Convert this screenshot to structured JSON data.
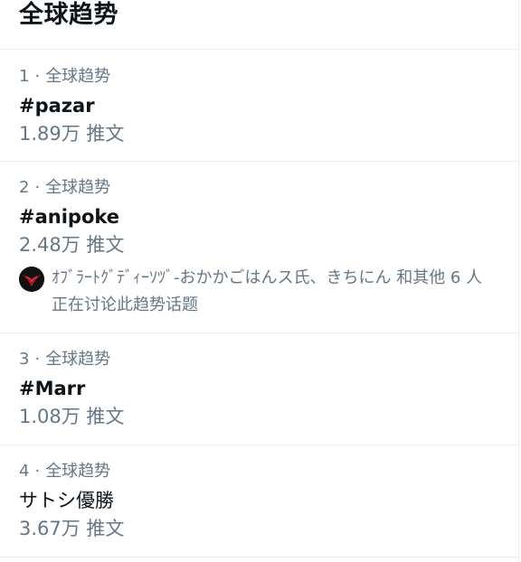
{
  "header": {
    "title": "全球趋势"
  },
  "trends": [
    {
      "rank": "1",
      "separator": "·",
      "category": "全球趋势",
      "name": "#pazar",
      "count": "1.89万 推文"
    },
    {
      "rank": "2",
      "separator": "·",
      "category": "全球趋势",
      "name": "#anipoke",
      "count": "2.48万 推文",
      "discussion": "ｵﾌﾞﾗｰﾄｸﾞﾃﾞｨｰｿﾂﾞ-おかかごはんス氏、きちにん 和其他 6 人正在讨论此趋势话题"
    },
    {
      "rank": "3",
      "separator": "·",
      "category": "全球趋势",
      "name": "#Marr",
      "count": "1.08万 推文"
    },
    {
      "rank": "4",
      "separator": "·",
      "category": "全球趋势",
      "name": "サトシ優勝",
      "count": "3.67万 推文"
    }
  ],
  "colors": {
    "text_primary": "#0f1419",
    "text_secondary": "#657786",
    "divider": "#e6ecf0",
    "avatar_bg": "#111111",
    "avatar_accent": "#d0102a"
  }
}
